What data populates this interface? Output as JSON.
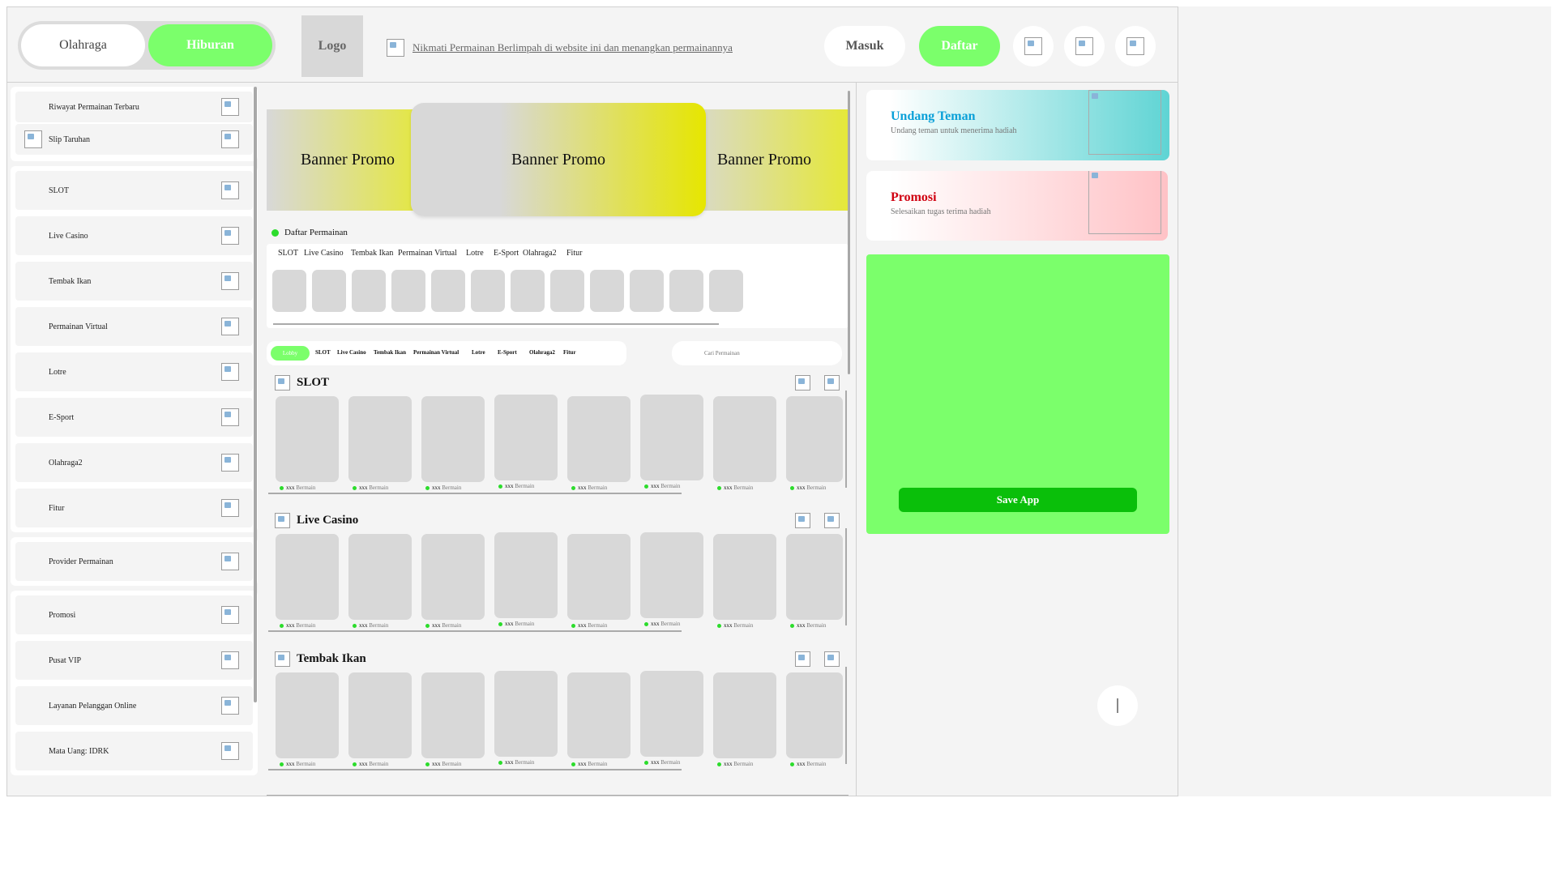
{
  "header": {
    "toggle": [
      "Olahraga",
      "Hiburan"
    ],
    "toggle_active": "Hiburan",
    "logo": "Logo",
    "marquee": "Nikmati Permainan Berlimpah di website ini dan menangkan permainannya",
    "login": "Masuk",
    "register": "Daftar",
    "icons": [
      "image-icon",
      "image-icon",
      "image-icon"
    ]
  },
  "sidebar": {
    "top": [
      "Riwayat Permainan Terbaru",
      "Slip Taruhan"
    ],
    "games": [
      "SLOT",
      "Live Casino",
      "Tembak Ikan",
      "Permainan Virtual",
      "Lotre",
      "E-Sport",
      "Olahraga2",
      "Fitur"
    ],
    "provider": [
      "Provider Permainan"
    ],
    "misc": [
      "Promosi",
      "Pusat VIP",
      "Layanan Pelanggan Online",
      "Mata Uang: IDRK"
    ]
  },
  "main": {
    "banners": [
      "Banner Promo",
      "Banner Promo",
      "Banner Promo"
    ],
    "game_list_label": "Daftar Permainan",
    "game_list_tabs": [
      "SLOT",
      "Live Casino",
      "Tembak Ikan",
      "Permainan Virtual",
      "Lotre",
      "E-Sport",
      "Olahraga2",
      "Fitur"
    ],
    "tabs": [
      "Lobby",
      "SLOT",
      "Live Casino",
      "Tembak Ikan",
      "Permainan Virtual",
      "Lotre",
      "E-Sport",
      "Olahraga2",
      "Fitur"
    ],
    "search_placeholder": "Cari Permainan",
    "card_count": "xxx",
    "card_suffix": "Bermain",
    "sections": [
      "SLOT",
      "Live Casino",
      "Tembak Ikan"
    ]
  },
  "right": {
    "invite": {
      "title": "Undang Teman",
      "subtitle": "Undang teman untuk menerima hadiah",
      "color": "#0aa0d8"
    },
    "promo": {
      "title": "Promosi",
      "subtitle": "Selesaikan tugas terima hadiah",
      "color": "#d00010"
    },
    "save_app": "Save App"
  },
  "colors": {
    "accent": "#7bff6b",
    "dark_green": "#0abf0a",
    "banner_yellow": "#e6e600"
  }
}
